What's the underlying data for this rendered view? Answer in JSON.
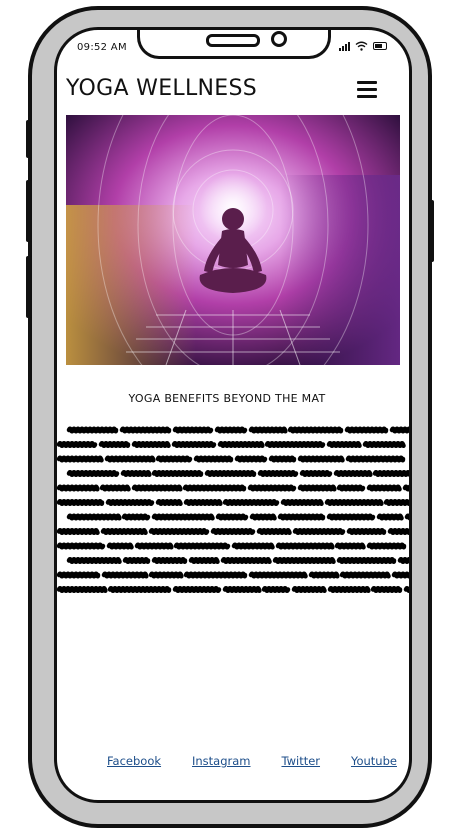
{
  "status_bar": {
    "time": "09:52 AM"
  },
  "header": {
    "title": "YOGA WELLNESS",
    "menu_icon": "hamburger-menu-icon"
  },
  "hero": {
    "image": "meditation-figure-lotus-pose",
    "colors": [
      "#2a0e3a",
      "#b13fa8",
      "#e6a3e6",
      "#d4a640",
      "#6a2a8a"
    ]
  },
  "content": {
    "heading": "YOGA BENEFITS BEYOND THE MAT",
    "placeholder_text_lines": 12
  },
  "footer": {
    "links": [
      {
        "label": "Facebook"
      },
      {
        "label": "Instagram"
      },
      {
        "label": "Twitter"
      },
      {
        "label": "Youtube"
      }
    ],
    "link_color": "#1d4e8a"
  }
}
